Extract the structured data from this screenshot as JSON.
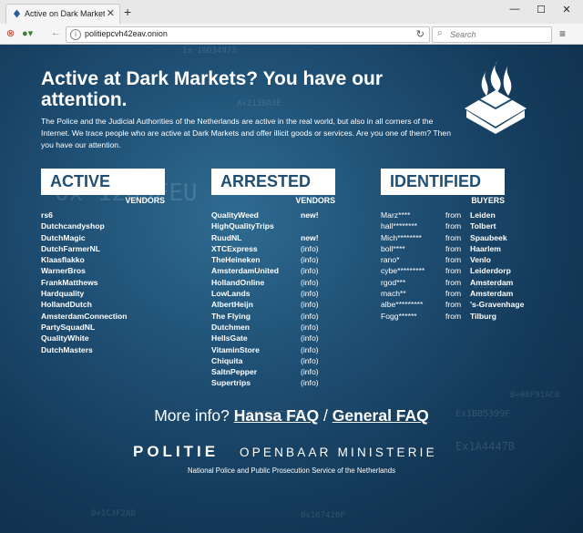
{
  "browser": {
    "tab_title": "Active on Dark Markets? Y...",
    "tab_close": "✕",
    "new_tab": "+",
    "window_controls": {
      "minimize": "—",
      "maximize": "☐",
      "close": "✕"
    },
    "url": "politiepcvh42eav.onion",
    "search_placeholder": "Search",
    "menu": "≡"
  },
  "page": {
    "headline": "Active at Dark Markets? You have our attention.",
    "intro": "The Police and the Judicial Authorities of the Netherlands are active in the real world, but also in all corners of the Internet. We trace people who are active at Dark Markets and offer illicit goods or services. Are you one of them? Then you have our attention.",
    "columns": {
      "active": {
        "title": "ACTIVE",
        "subtitle": "VENDORS",
        "items": [
          "rs6",
          "Dutchcandyshop",
          "DutchMagic",
          "DutchFarmerNL",
          "Klaasflakko",
          "WarnerBros",
          "FrankMatthews",
          "Hardquality",
          "HollandDutch",
          "AmsterdamConnection",
          "PartySquadNL",
          "QualityWhite",
          "DutchMasters"
        ]
      },
      "arrested": {
        "title": "ARRESTED",
        "subtitle": "VENDORS",
        "items": [
          {
            "name": "QualityWeed",
            "tag": "new!"
          },
          {
            "name": "HighQualityTrips",
            "tag": ""
          },
          {
            "name": "RuudNL",
            "tag": "new!"
          },
          {
            "name": "XTCExpress",
            "tag": "(info)"
          },
          {
            "name": "TheHeineken",
            "tag": "(info)"
          },
          {
            "name": "AmsterdamUnited",
            "tag": "(info)"
          },
          {
            "name": "HollandOnline",
            "tag": "(info)"
          },
          {
            "name": "LowLands",
            "tag": "(info)"
          },
          {
            "name": "AlbertHeijn",
            "tag": "(info)"
          },
          {
            "name": "The Flying",
            "tag": "(info)"
          },
          {
            "name": "Dutchmen",
            "tag": "(info)"
          },
          {
            "name": "HellsGate",
            "tag": "(info)"
          },
          {
            "name": "VitaminStore",
            "tag": "(info)"
          },
          {
            "name": "Chiquita",
            "tag": "(info)"
          },
          {
            "name": "SaltnPepper",
            "tag": "(info)"
          },
          {
            "name": "Supertrips",
            "tag": "(info)"
          }
        ]
      },
      "identified": {
        "title": "IDENTIFIED",
        "subtitle": "BUYERS",
        "items": [
          {
            "name": "Marz****",
            "from": "from",
            "city": "Leiden"
          },
          {
            "name": "hall********",
            "from": "from",
            "city": "Tolbert"
          },
          {
            "name": "Mich********",
            "from": "from",
            "city": "Spaubeek"
          },
          {
            "name": "boll****",
            "from": "from",
            "city": "Haarlem"
          },
          {
            "name": "rano*",
            "from": "from",
            "city": "Venlo"
          },
          {
            "name": "cybe*********",
            "from": "from",
            "city": "Leiderdorp"
          },
          {
            "name": "rgod***",
            "from": "from",
            "city": "Amsterdam"
          },
          {
            "name": "mach**",
            "from": "from",
            "city": "Amsterdam"
          },
          {
            "name": "albe*********",
            "from": "from",
            "city": "'s-Gravenhage"
          },
          {
            "name": "Fogg******",
            "from": "from",
            "city": "Tilburg"
          }
        ]
      }
    },
    "faq": {
      "prefix": "More info?",
      "hansa": "Hansa FAQ",
      "separator": "/",
      "general": "General FAQ"
    },
    "politie_logo": "POLITIE",
    "om_logo": "OPENBAAR MINISTERIE",
    "footer": "National Police and Public Prosecution Service of the Netherlands"
  },
  "colors": {
    "page_bg": "#1f4f74",
    "heading_box": "#ffffff",
    "heading_text": "#1f4f74"
  }
}
